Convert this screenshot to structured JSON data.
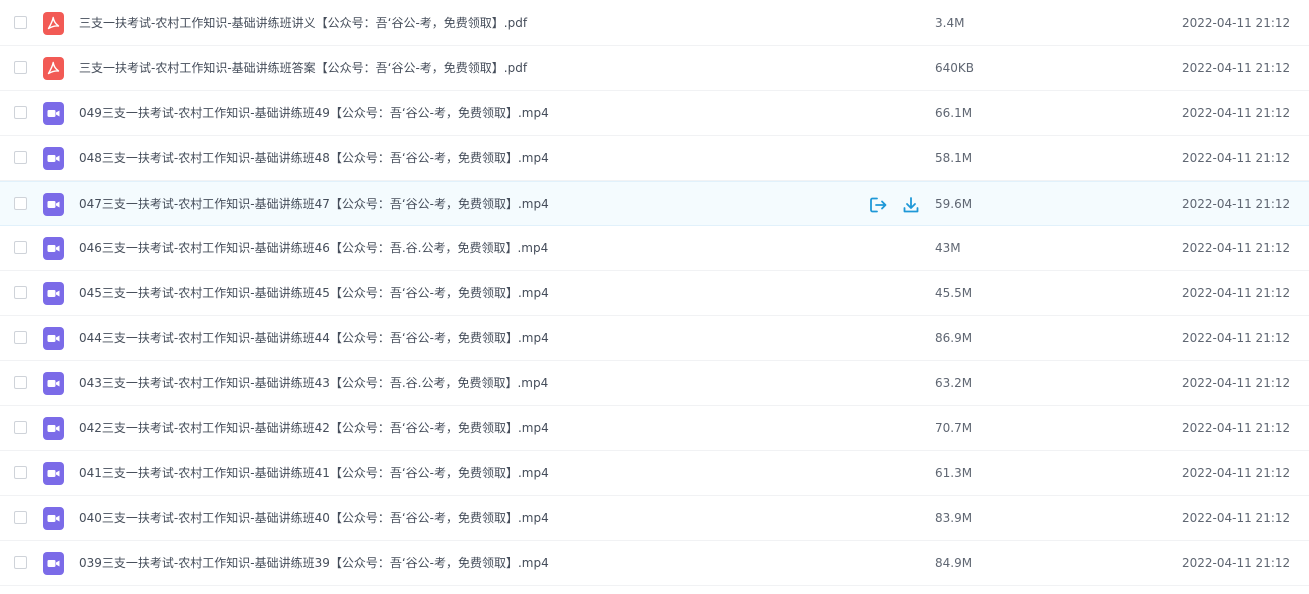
{
  "colors": {
    "pdf_icon": "#f25a55",
    "video_icon": "#7b6be8",
    "action_blue": "#1e98d7",
    "hover_row": "#f4fbfe"
  },
  "files": [
    {
      "name": "三支一扶考试-农村工作知识-基础讲练班讲义【公众号：吾‘谷公-考，免费领取】.pdf",
      "type": "pdf",
      "icon": "pdf-icon",
      "size": "3.4M",
      "date": "2022-04-11 21:12"
    },
    {
      "name": "三支一扶考试-农村工作知识-基础讲练班答案【公众号：吾‘谷公-考，免费领取】.pdf",
      "type": "pdf",
      "icon": "pdf-icon",
      "size": "640KB",
      "date": "2022-04-11 21:12"
    },
    {
      "name": "049三支一扶考试-农村工作知识-基础讲练班49【公众号：吾‘谷公-考，免费领取】.mp4",
      "type": "video",
      "icon": "video-icon",
      "size": "66.1M",
      "date": "2022-04-11 21:12"
    },
    {
      "name": "048三支一扶考试-农村工作知识-基础讲练班48【公众号：吾‘谷公-考，免费领取】.mp4",
      "type": "video",
      "icon": "video-icon",
      "size": "58.1M",
      "date": "2022-04-11 21:12"
    },
    {
      "name": "047三支一扶考试-农村工作知识-基础讲练班47【公众号：吾‘谷公-考，免费领取】.mp4",
      "type": "video",
      "icon": "video-icon",
      "size": "59.6M",
      "date": "2022-04-11 21:12",
      "hovered": true
    },
    {
      "name": "046三支一扶考试-农村工作知识-基础讲练班46【公众号：吾.谷.公考，免费领取】.mp4",
      "type": "video",
      "icon": "video-icon",
      "size": "43M",
      "date": "2022-04-11 21:12"
    },
    {
      "name": "045三支一扶考试-农村工作知识-基础讲练班45【公众号：吾‘谷公-考，免费领取】.mp4",
      "type": "video",
      "icon": "video-icon",
      "size": "45.5M",
      "date": "2022-04-11 21:12"
    },
    {
      "name": "044三支一扶考试-农村工作知识-基础讲练班44【公众号：吾‘谷公-考，免费领取】.mp4",
      "type": "video",
      "icon": "video-icon",
      "size": "86.9M",
      "date": "2022-04-11 21:12"
    },
    {
      "name": "043三支一扶考试-农村工作知识-基础讲练班43【公众号：吾.谷.公考，免费领取】.mp4",
      "type": "video",
      "icon": "video-icon",
      "size": "63.2M",
      "date": "2022-04-11 21:12"
    },
    {
      "name": "042三支一扶考试-农村工作知识-基础讲练班42【公众号：吾‘谷公-考，免费领取】.mp4",
      "type": "video",
      "icon": "video-icon",
      "size": "70.7M",
      "date": "2022-04-11 21:12"
    },
    {
      "name": "041三支一扶考试-农村工作知识-基础讲练班41【公众号：吾‘谷公-考，免费领取】.mp4",
      "type": "video",
      "icon": "video-icon",
      "size": "61.3M",
      "date": "2022-04-11 21:12"
    },
    {
      "name": "040三支一扶考试-农村工作知识-基础讲练班40【公众号：吾‘谷公-考，免费领取】.mp4",
      "type": "video",
      "icon": "video-icon",
      "size": "83.9M",
      "date": "2022-04-11 21:12"
    },
    {
      "name": "039三支一扶考试-农村工作知识-基础讲练班39【公众号：吾‘谷公-考，免费领取】.mp4",
      "type": "video",
      "icon": "video-icon",
      "size": "84.9M",
      "date": "2022-04-11 21:12"
    }
  ],
  "row_actions": [
    {
      "icon": "share-icon"
    },
    {
      "icon": "download-icon"
    }
  ]
}
